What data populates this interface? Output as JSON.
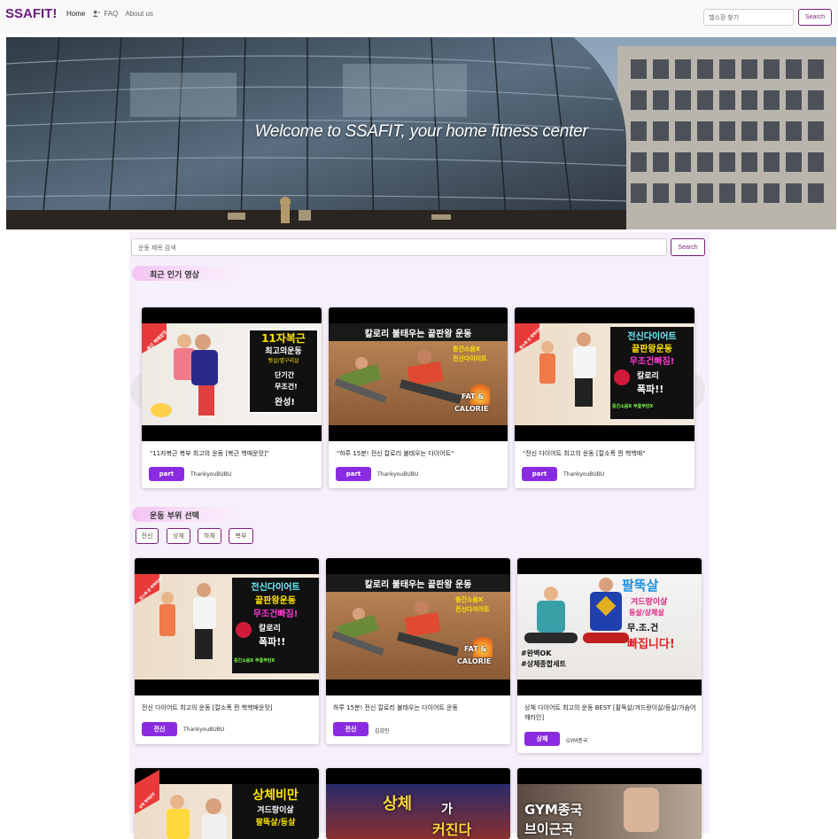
{
  "navbar": {
    "brand": "SSAFIT!",
    "links": [
      "Home",
      "FAQ",
      "About us"
    ],
    "search_placeholder": "헬스장 찾기",
    "search_button": "Search"
  },
  "hero": {
    "title": "Welcome to SSAFIT, your home fitness center"
  },
  "video_search": {
    "placeholder": "운동 제목 검색",
    "button": "Search"
  },
  "popular": {
    "title": "최근 인기 영상",
    "cards": [
      {
        "caption": "\"11자복근 복부 최고의 운동 [복근 핵매운맛]\"",
        "badge": "part",
        "channel": "ThankyouBUBU",
        "thumb_lines": [
          "11자복근",
          "최고의운동",
          "뱃살/옆구리살",
          "단기간",
          "무조건!",
          "완성!"
        ],
        "corner": "복근 핵매운맛"
      },
      {
        "caption": "\"하루 15분! 전신 칼로리 불태우는 다이어트\"",
        "badge": "part",
        "channel": "ThankyouBUBU",
        "thumb_lines": [
          "칼로리 불태우는 끝판왕 운동",
          "층간소음X",
          "전신다이어트",
          "FAT &",
          "CALORIE"
        ],
        "corner": ""
      },
      {
        "caption": "\"전신 다이어트 최고의 운동 [칼소폭 찐 핵핵매\"",
        "badge": "part",
        "channel": "ThankyouBUBU",
        "thumb_lines": [
          "전신다이어트",
          "끝판왕운동",
          "무조건빠짐!",
          "칼로리",
          "폭파!!",
          "층간소음X 무릎부담X"
        ],
        "corner": "칼소폭 찐 핵핵매운맛"
      }
    ]
  },
  "body_part": {
    "title": "운동 부위 선택",
    "filters": [
      "전신",
      "상체",
      "하체",
      "복부"
    ],
    "cards": [
      {
        "caption": "전신 다이어트 최고의 운동 [칼소폭 찐 핵핵매운맛]",
        "badge": "전신",
        "channel": "ThankyouBUBU",
        "thumb_lines": [
          "전신다이어트",
          "끝판왕운동",
          "무조건빠짐!",
          "칼로리",
          "폭파!!",
          "층간소음X 무릎부담X"
        ],
        "corner": "칼소폭 찐 핵핵매운맛"
      },
      {
        "caption": "하루 15분! 전신 칼로리 불태우는 다이어트 운동",
        "badge": "전신",
        "channel": "김강민",
        "thumb_lines": [
          "칼로리 불태우는 끝판왕 운동",
          "층간소음X",
          "전신다이어트",
          "FAT &",
          "CALORIE"
        ],
        "corner": ""
      },
      {
        "caption": "상체 다이어트 최고의 운동 BEST [팔뚝살/겨드랑이살/등살/가슴어깨라인]",
        "badge": "상체",
        "channel": "GYM종국",
        "thumb_lines": [
          "팔뚝살",
          "겨드랑이살",
          "등살/상체살",
          "무.조.건",
          "빠집니다!",
          "#완벽OK",
          "#상체종합세트"
        ],
        "corner": ""
      }
    ],
    "more_thumbs": [
      {
        "thumb_lines": [
          "상체비만",
          "겨드랑이살",
          "팔뚝살/등살"
        ],
        "corner": "상체 핵매운맛"
      },
      {
        "thumb_lines": [
          "상체",
          "가",
          "커진다"
        ],
        "corner": ""
      },
      {
        "thumb_lines": [
          "GYM종국",
          "브이근국"
        ],
        "corner": ""
      }
    ]
  },
  "colors": {
    "brand": "#6a1b7e",
    "accent": "#8a2be2",
    "panel": "#f6f0fb"
  }
}
